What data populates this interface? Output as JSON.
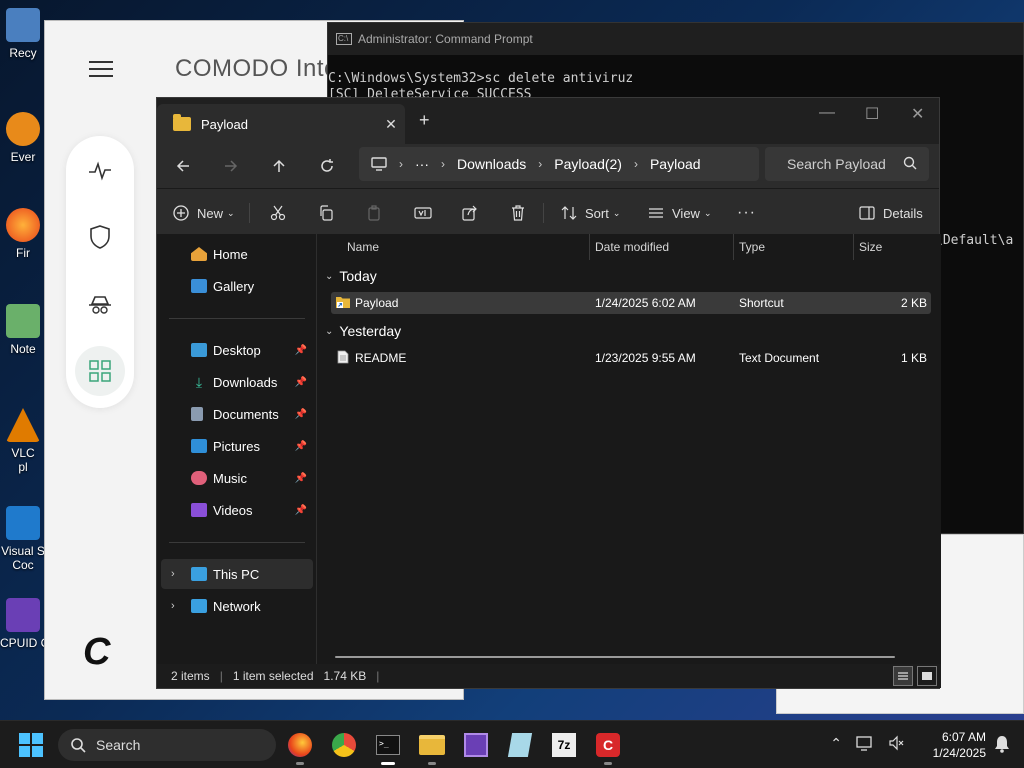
{
  "desktop": {
    "icons": [
      {
        "label": "Recy",
        "color": "#2a6ebd"
      },
      {
        "label": "Ever",
        "color": "#e88a1a"
      },
      {
        "label": "Fir",
        "color": "#e85c1a"
      },
      {
        "label": "Note",
        "color": "#3b8f3b"
      },
      {
        "label": "VLC",
        "label2": "pl",
        "color": "#e07b00"
      },
      {
        "label": "Visual S",
        "label2": "Coc",
        "color": "#1f7acc"
      },
      {
        "label": "CPUID C",
        "color": "#6a3fb5"
      }
    ]
  },
  "comodo": {
    "title": "COMODO Inte",
    "logo": "C"
  },
  "cmd": {
    "title": "Administrator: Command Prompt",
    "line1": "C:\\Windows\\System32>sc delete antiviruz",
    "line2": "[SC] DeleteService SUCCESS",
    "partial": "\\Default\\a"
  },
  "explorer": {
    "tab_title": "Payload",
    "breadcrumb": [
      "Downloads",
      "Payload(2)",
      "Payload"
    ],
    "more_crumbs": "···",
    "search_placeholder": "Search Payload",
    "toolbar": {
      "new": "New",
      "sort": "Sort",
      "view": "View",
      "more": "···",
      "details": "Details"
    },
    "nav": {
      "home": "Home",
      "gallery": "Gallery",
      "desktop": "Desktop",
      "downloads": "Downloads",
      "documents": "Documents",
      "pictures": "Pictures",
      "music": "Music",
      "videos": "Videos",
      "thispc": "This PC",
      "network": "Network"
    },
    "columns": [
      "Name",
      "Date modified",
      "Type",
      "Size"
    ],
    "groups": [
      {
        "title": "Today",
        "files": [
          {
            "name": "Payload",
            "date": "1/24/2025 6:02 AM",
            "type": "Shortcut",
            "size": "2 KB",
            "selected": true
          }
        ]
      },
      {
        "title": "Yesterday",
        "files": [
          {
            "name": "README",
            "date": "1/23/2025 9:55 AM",
            "type": "Text Document",
            "size": "1 KB",
            "selected": false
          }
        ]
      }
    ],
    "status": {
      "items": "2 items",
      "selected": "1 item selected",
      "size": "1.74 KB"
    }
  },
  "taskbar": {
    "search": "Search",
    "time": "6:07 AM",
    "date": "1/24/2025",
    "accent": "#4cc2ff"
  }
}
